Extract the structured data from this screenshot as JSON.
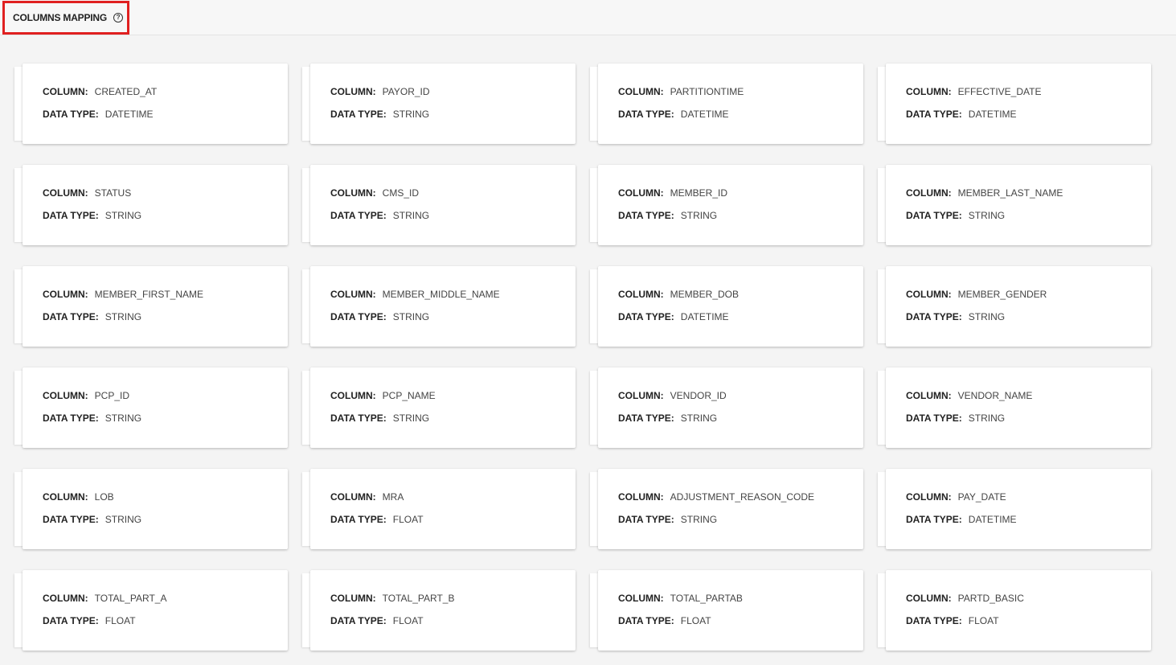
{
  "header": {
    "title": "COLUMNS MAPPING",
    "help_icon": "help-circle-icon"
  },
  "labels": {
    "column": "COLUMN:",
    "data_type": "DATA TYPE:"
  },
  "columns": [
    {
      "column": "CREATED_AT",
      "data_type": "DATETIME"
    },
    {
      "column": "PAYOR_ID",
      "data_type": "STRING"
    },
    {
      "column": "PARTITIONTIME",
      "data_type": "DATETIME"
    },
    {
      "column": "EFFECTIVE_DATE",
      "data_type": "DATETIME"
    },
    {
      "column": "STATUS",
      "data_type": "STRING"
    },
    {
      "column": "CMS_ID",
      "data_type": "STRING"
    },
    {
      "column": "MEMBER_ID",
      "data_type": "STRING"
    },
    {
      "column": "MEMBER_LAST_NAME",
      "data_type": "STRING"
    },
    {
      "column": "MEMBER_FIRST_NAME",
      "data_type": "STRING"
    },
    {
      "column": "MEMBER_MIDDLE_NAME",
      "data_type": "STRING"
    },
    {
      "column": "MEMBER_DOB",
      "data_type": "DATETIME"
    },
    {
      "column": "MEMBER_GENDER",
      "data_type": "STRING"
    },
    {
      "column": "PCP_ID",
      "data_type": "STRING"
    },
    {
      "column": "PCP_NAME",
      "data_type": "STRING"
    },
    {
      "column": "VENDOR_ID",
      "data_type": "STRING"
    },
    {
      "column": "VENDOR_NAME",
      "data_type": "STRING"
    },
    {
      "column": "LOB",
      "data_type": "STRING"
    },
    {
      "column": "MRA",
      "data_type": "FLOAT"
    },
    {
      "column": "ADJUSTMENT_REASON_CODE",
      "data_type": "STRING"
    },
    {
      "column": "PAY_DATE",
      "data_type": "DATETIME"
    },
    {
      "column": "TOTAL_PART_A",
      "data_type": "FLOAT"
    },
    {
      "column": "TOTAL_PART_B",
      "data_type": "FLOAT"
    },
    {
      "column": "TOTAL_PARTAB",
      "data_type": "FLOAT"
    },
    {
      "column": "PARTD_BASIC",
      "data_type": "FLOAT"
    }
  ]
}
